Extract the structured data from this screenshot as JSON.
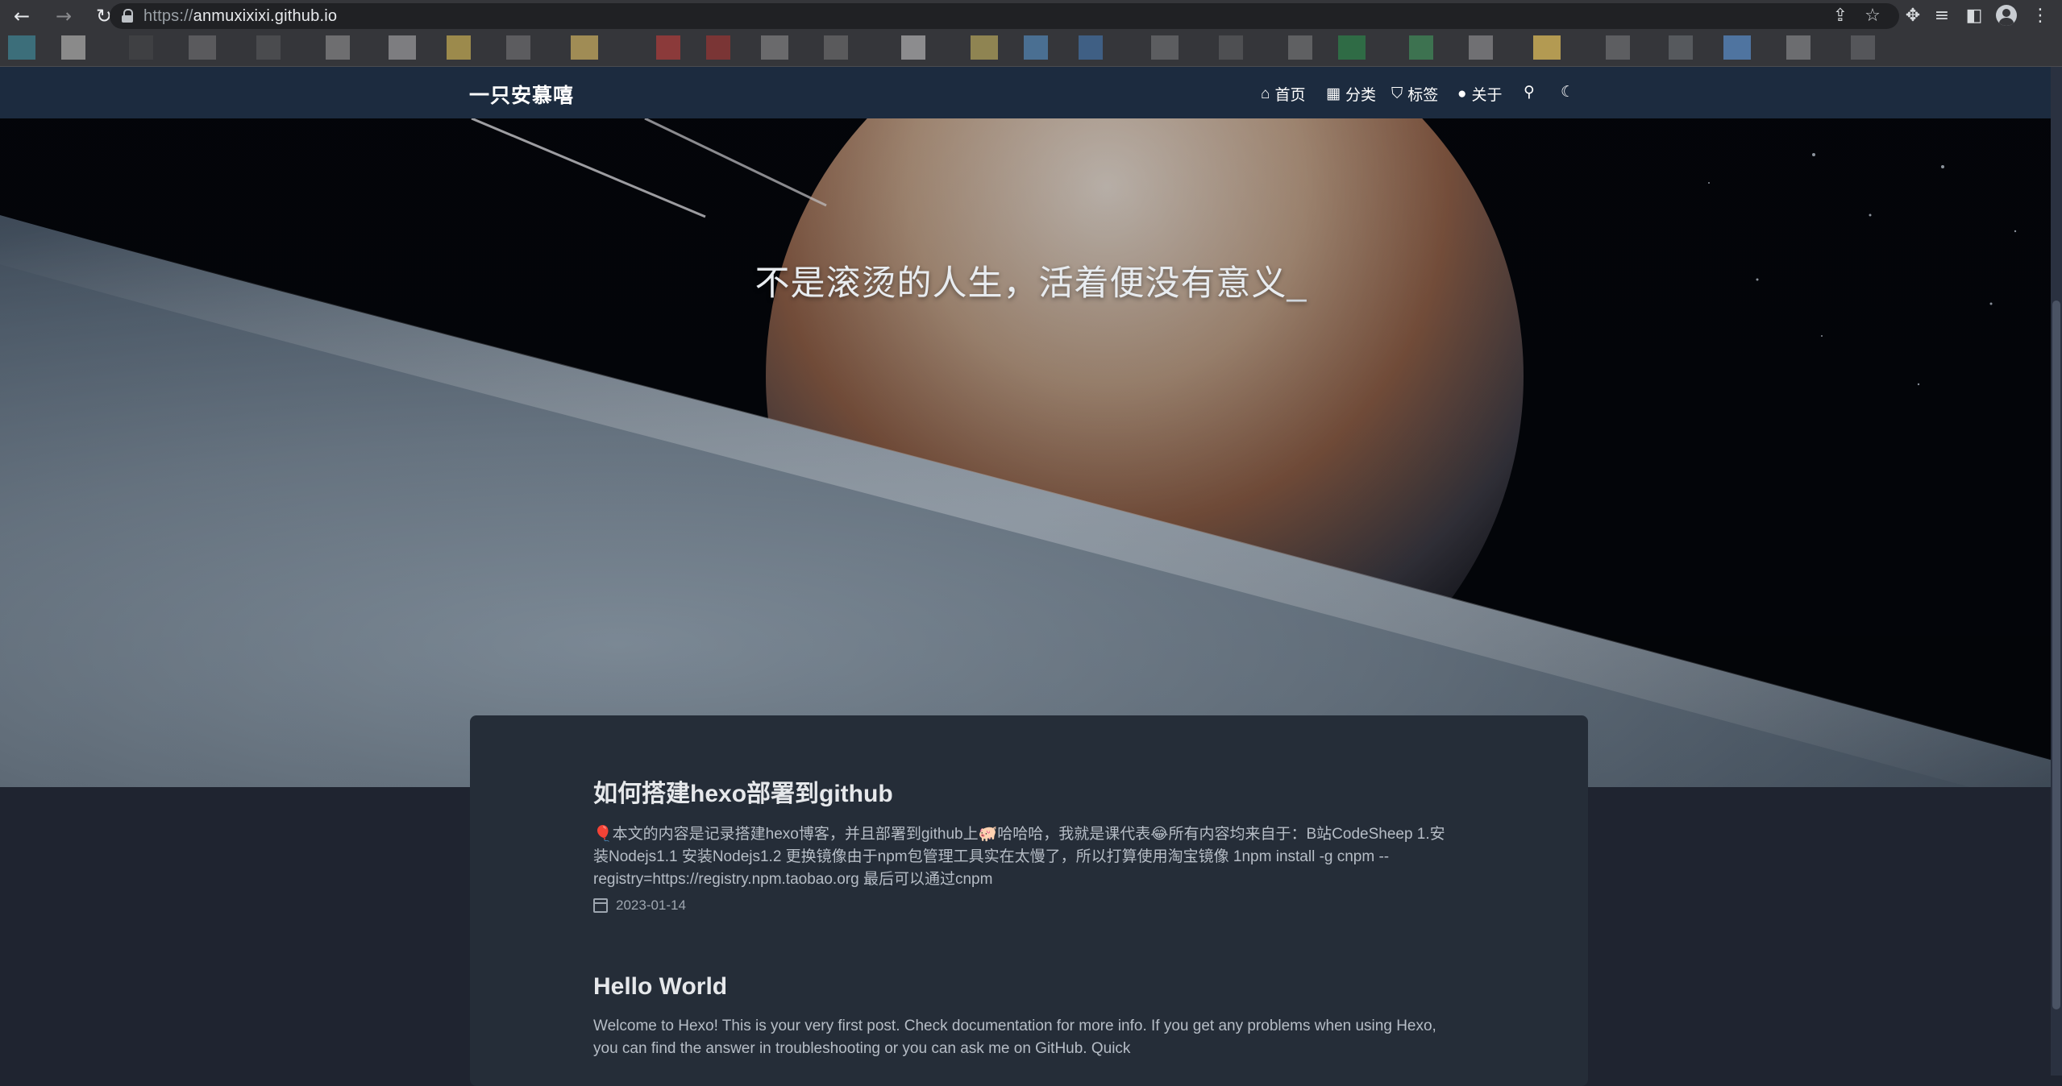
{
  "browser": {
    "url_scheme": "https://",
    "url_host": "anmuxixixi.github.io",
    "icons": {
      "back": "←",
      "forward": "→",
      "reload": "↻",
      "share": "⇪",
      "star": "☆",
      "extensions": "✥",
      "media": "≡",
      "side_panel": "◧",
      "menu": "⋮"
    },
    "bookmark_colors": [
      "#3c6e7a",
      "#8a8a8a",
      "#3f4043",
      "#5a5a5d",
      "#4a4b4e",
      "#6e6e70",
      "#7d7d80",
      "#9c8a4c",
      "#5c5c5f",
      "#a08c55",
      "#8b3a3a",
      "#7a3535",
      "#6a6a6c",
      "#5a5a5c",
      "#8c8c8e",
      "#8f8452",
      "#4a6f92",
      "#3f5f84",
      "#5c5d60",
      "#4e4f52",
      "#5f6062",
      "#2f6b45",
      "#3d7250",
      "#707073",
      "#b39a52",
      "#5d5e61",
      "#56595d",
      "#4f74a0",
      "#6c6d70",
      "#55565a"
    ]
  },
  "site": {
    "title": "一只安慕嘻",
    "menu": {
      "home": "首页",
      "categories": "分类",
      "tags": "标签",
      "about": "关于"
    },
    "menu_icons": {
      "home": "⌂",
      "categories": "▦",
      "tags": "⛉",
      "about": "●",
      "search": "⚲",
      "dark_mode": "☾"
    },
    "slogan": "不是滚烫的人生，活着便没有意义",
    "slogan_cursor": "_"
  },
  "posts": [
    {
      "title": "如何搭建hexo部署到github",
      "excerpt": "🎈本文的内容是记录搭建hexo博客，并且部署到github上🐖哈哈哈，我就是课代表😂所有内容均来自于：B站CodeSheep 1.安装Nodejs1.1 安装Nodejs1.2 更换镜像由于npm包管理工具实在太慢了，所以打算使用淘宝镜像 1npm install -g cnpm --registry=https://registry.npm.taobao.org 最后可以通过cnpm",
      "date": "2023-01-14"
    },
    {
      "title": "Hello World",
      "excerpt": "Welcome to Hexo! This is your very first post. Check documentation for more info. If you get any problems when using Hexo, you can find the answer in troubleshooting or you can ask me on GitHub. Quick",
      "date": ""
    }
  ],
  "colors": {
    "header_bg": "#1c2b3f",
    "page_bg": "#1f2430",
    "card_bg": "#252d38"
  }
}
